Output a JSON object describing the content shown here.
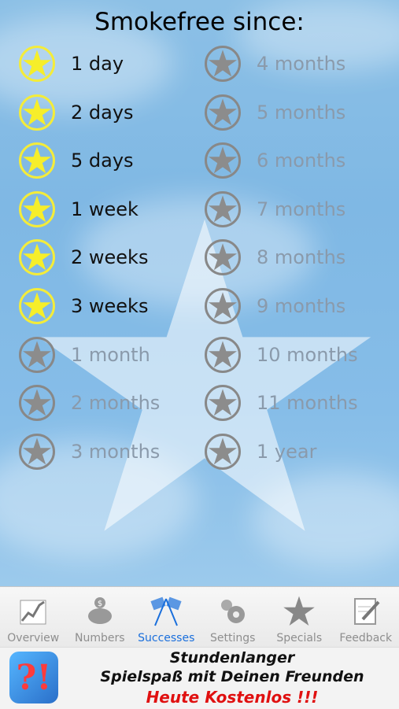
{
  "title": "Smokefree since:",
  "achievements_left": [
    {
      "label": "1 day",
      "achieved": true
    },
    {
      "label": "2 days",
      "achieved": true
    },
    {
      "label": "5 days",
      "achieved": true
    },
    {
      "label": "1 week",
      "achieved": true
    },
    {
      "label": "2 weeks",
      "achieved": true
    },
    {
      "label": "3 weeks",
      "achieved": true
    },
    {
      "label": "1 month",
      "achieved": false
    },
    {
      "label": "2 months",
      "achieved": false
    },
    {
      "label": "3 months",
      "achieved": false
    }
  ],
  "achievements_right": [
    {
      "label": "4 months",
      "achieved": false
    },
    {
      "label": "5 months",
      "achieved": false
    },
    {
      "label": "6 months",
      "achieved": false
    },
    {
      "label": "7 months",
      "achieved": false
    },
    {
      "label": "8 months",
      "achieved": false
    },
    {
      "label": "9 months",
      "achieved": false
    },
    {
      "label": "10 months",
      "achieved": false
    },
    {
      "label": "11 months",
      "achieved": false
    },
    {
      "label": "1 year",
      "achieved": false
    }
  ],
  "colors": {
    "achieved_star": "#f6ee2a",
    "pending_star": "#8c8c8c",
    "active_tab": "#1a6fdc",
    "inactive_tab": "#8e8e8e"
  },
  "tabs": [
    {
      "label": "Overview",
      "icon": "chart-icon",
      "active": false
    },
    {
      "label": "Numbers",
      "icon": "piggy-bank-icon",
      "active": false
    },
    {
      "label": "Successes",
      "icon": "checkered-flags-icon",
      "active": true
    },
    {
      "label": "Settings",
      "icon": "gears-icon",
      "active": false
    },
    {
      "label": "Specials",
      "icon": "star-icon",
      "active": false
    },
    {
      "label": "Feedback",
      "icon": "notepad-pencil-icon",
      "active": false
    }
  ],
  "ad": {
    "logo_text": "?!",
    "line1": "Stundenlanger",
    "line2": "Spielspaß mit Deinen Freunden",
    "line3": "Heute Kostenlos !!!"
  }
}
